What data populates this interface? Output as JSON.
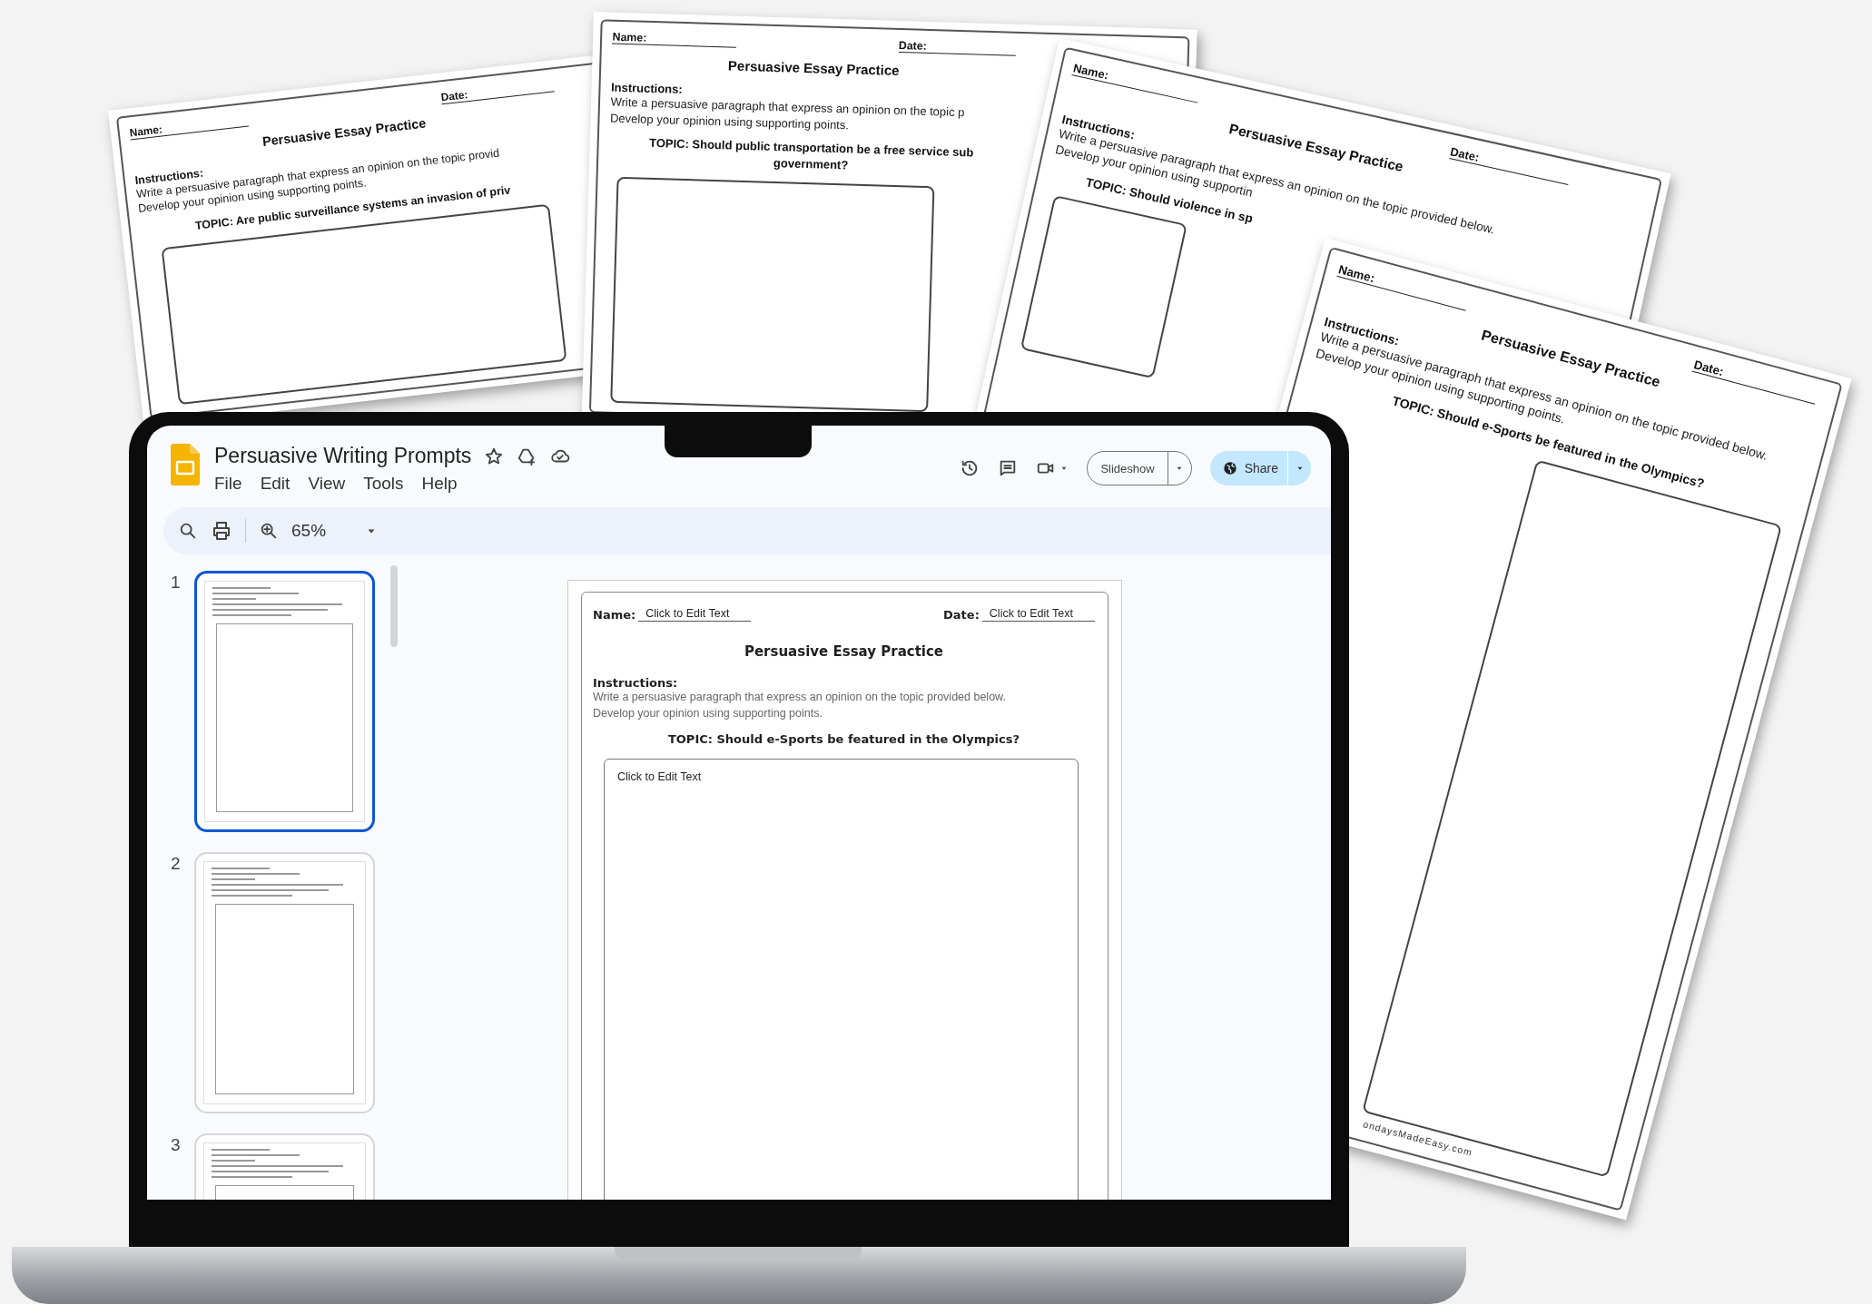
{
  "worksheets": [
    {
      "name_label": "Name:",
      "date_label": "Date:",
      "title": "Persuasive Essay Practice",
      "instructions_label": "Instructions:",
      "instructions": [
        "Write a persuasive paragraph that express an opinion on the topic provid",
        "Develop your opinion using supporting points."
      ],
      "topic": [
        "TOPIC: Are public surveillance systems an invasion of priv"
      ]
    },
    {
      "name_label": "Name:",
      "date_label": "Date:",
      "title": "Persuasive Essay Practice",
      "instructions_label": "Instructions:",
      "instructions": [
        "Write a persuasive paragraph that express an opinion on the topic p",
        "Develop your opinion using supporting points."
      ],
      "topic": [
        "TOPIC: Should public transportation be a free service sub",
        "government?"
      ]
    },
    {
      "name_label": "Name:",
      "date_label": "Date:",
      "title": "Persuasive Essay Practice",
      "instructions_label": "Instructions:",
      "instructions": [
        "Write a persuasive paragraph that express an opinion on the topic provided below.",
        "Develop your opinion using supportin"
      ],
      "topic": [
        "TOPIC: Should violence in sp"
      ]
    },
    {
      "name_label": "Name:",
      "date_label": "Date:",
      "title": "Persuasive Essay Practice",
      "instructions_label": "Instructions:",
      "instructions": [
        "Write a persuasive paragraph that express an opinion on the topic provided below.",
        "Develop your opinion using supporting points."
      ],
      "topic": [
        "TOPIC: Should e-Sports be featured in the Olympics?"
      ],
      "footer": "ondaysMadeEasy.com"
    }
  ],
  "app": {
    "title": "Persuasive Writing Prompts",
    "menu": [
      "File",
      "Edit",
      "View",
      "Tools",
      "Help"
    ],
    "zoom": "65%",
    "slideshow": "Slideshow",
    "share": "Share",
    "thumbnails": [
      {
        "number": "1",
        "selected": true
      },
      {
        "number": "2",
        "selected": false
      },
      {
        "number": "3",
        "selected": false
      }
    ],
    "slide": {
      "name_label": "Name:",
      "name_value": "Click to Edit Text",
      "date_label": "Date:",
      "date_value": "Click to Edit Text",
      "title": "Persuasive Essay Practice",
      "instructions_label": "Instructions:",
      "instructions": [
        "Write a persuasive paragraph that express an opinion on the topic provided below.",
        "Develop your opinion using supporting points."
      ],
      "topic": "TOPIC: Should e-Sports be featured in the Olympics?",
      "answer": "Click to Edit Text"
    }
  }
}
